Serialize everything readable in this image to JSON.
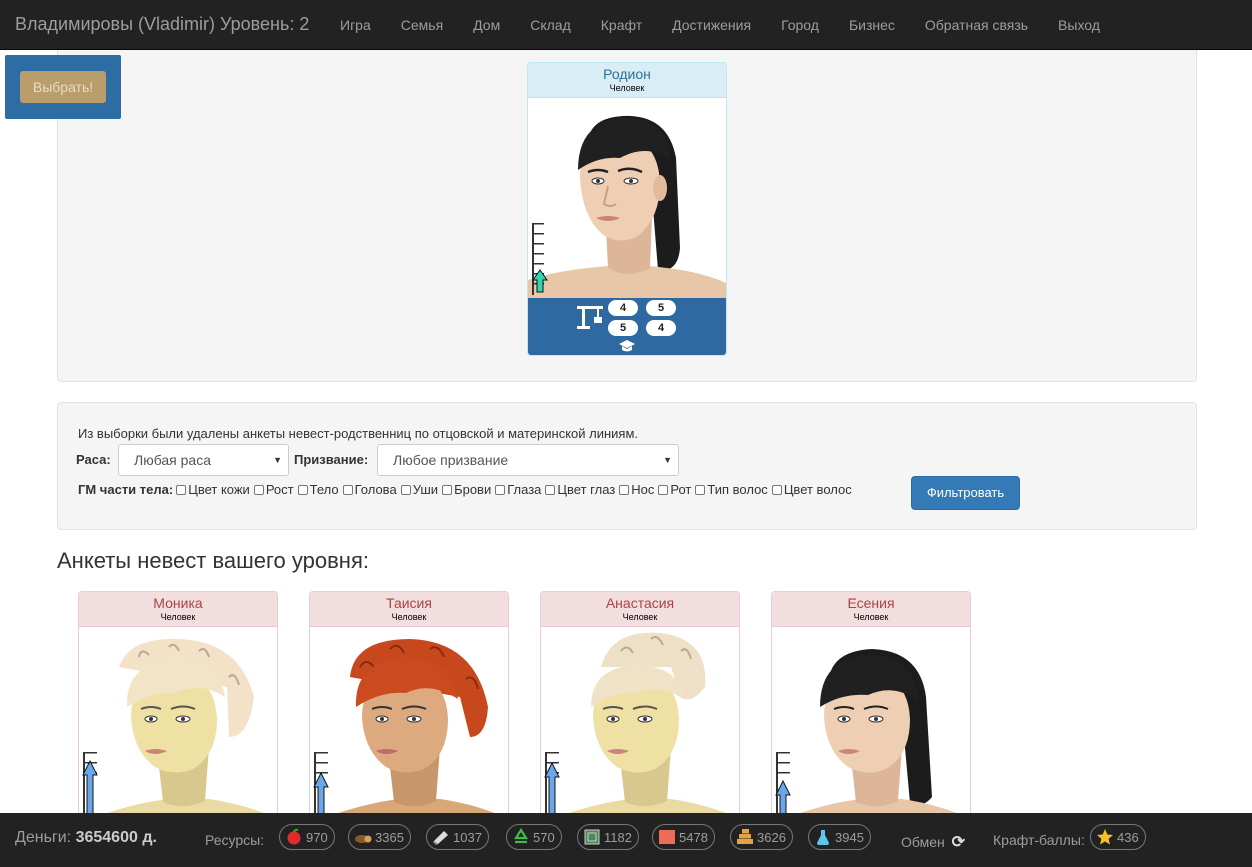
{
  "navbar": {
    "brand": "Владимировы (Vladimir) Уровень: 2",
    "links": [
      "Игра",
      "Семья",
      "Дом",
      "Склад",
      "Крафт",
      "Достижения",
      "Город",
      "Бизнес",
      "Обратная связь",
      "Выход"
    ]
  },
  "choose_button": "Выбрать!",
  "groom": {
    "name": "Родион",
    "race": "Человек",
    "stats": [
      "4",
      "5",
      "5",
      "4"
    ]
  },
  "filter": {
    "note": "Из выборки были удалены анкеты невест-родственниц по отцовской и материнской линиям.",
    "race_label": "Раса:",
    "race_value": "Любая раса",
    "vocation_label": "Призвание:",
    "vocation_value": "Любое призвание",
    "gm_label": "ГМ части тела:",
    "parts": [
      "Цвет кожи",
      "Рост",
      "Тело",
      "Голова",
      "Уши",
      "Брови",
      "Глаза",
      "Цвет глаз",
      "Нос",
      "Рот",
      "Тип волос",
      "Цвет волос"
    ],
    "button": "Фильтровать"
  },
  "brides_title": "Анкеты невест вашего уровня:",
  "brides": [
    {
      "name": "Моника",
      "race": "Человек"
    },
    {
      "name": "Таисия",
      "race": "Человек"
    },
    {
      "name": "Анастасия",
      "race": "Человек"
    },
    {
      "name": "Есения",
      "race": "Человек"
    }
  ],
  "footer": {
    "money_label": "Деньги:",
    "money_value": "3654600 д.",
    "resources_label": "Ресурсы:",
    "resources": [
      {
        "icon": "apple-icon",
        "value": "970"
      },
      {
        "icon": "wood-icon",
        "value": "3365"
      },
      {
        "icon": "stone-icon",
        "value": "1037"
      },
      {
        "icon": "recycle-icon",
        "value": "570"
      },
      {
        "icon": "crate-icon",
        "value": "1182"
      },
      {
        "icon": "cloth-icon",
        "value": "5478"
      },
      {
        "icon": "bricks-icon",
        "value": "3626"
      },
      {
        "icon": "potion-icon",
        "value": "3945"
      }
    ],
    "exchange_label": "Обмен",
    "craft_label": "Крафт-баллы:",
    "craft_value": "436"
  },
  "colors": {
    "navbar": "#222222",
    "primary": "#337ab7",
    "card_female_head": "#f2dede",
    "card_male_head": "#d9edf7"
  }
}
